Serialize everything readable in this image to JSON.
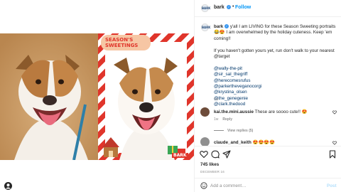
{
  "post": {
    "username": "bark",
    "follow_label": "Follow",
    "separator": "•",
    "verified_glyph": "✓",
    "avatar_text": "BARK"
  },
  "caption": {
    "username": "bark",
    "verified_glyph": "✓",
    "line1": "y'all I am LIVING for these Season Sweeting portraits😂😍 I am overwhelmed by the holiday cuteness. Keep 'em coming!!",
    "line2": "If you haven't gotten yours yet, run don't walk to your nearest @target",
    "tags": [
      "@wally-the-pit",
      "@sir_sal_thegriff",
      "@herecomesrufus",
      "@parkertheveganocorgi",
      "@krystina_olsen",
      "@the_genegenie",
      "@clark.thedood"
    ],
    "time": "1w"
  },
  "comments": [
    {
      "username": "kai.the.mini.aussie",
      "text": "These are soooo cute!! 😍",
      "time": "1w",
      "reply_label": "Reply"
    },
    {
      "username": "claude_and_keith",
      "text": "😍😍😍😍"
    }
  ],
  "view_replies_label": "View replies (5)",
  "likes": "745 likes",
  "date": "DECEMBER 16",
  "add_comment": {
    "placeholder": "Add a comment…",
    "post_label": "Post",
    "emoji_icon": "emoji-icon"
  },
  "artwork": {
    "title_line1": "SEASON'S",
    "title_line2": "SWEETINGS",
    "brand": "BARK"
  },
  "colors": {
    "link_blue": "#0095f6",
    "tag_blue": "#00376b",
    "verified": "#3897f0",
    "muted": "#8e8e8e",
    "text": "#262626",
    "candy_red": "#e0352b",
    "post_disabled": "#b2dffc"
  },
  "icons": [
    "heart-icon",
    "comment-icon",
    "share-icon",
    "bookmark-icon",
    "emoji-icon",
    "verified-icon"
  ]
}
